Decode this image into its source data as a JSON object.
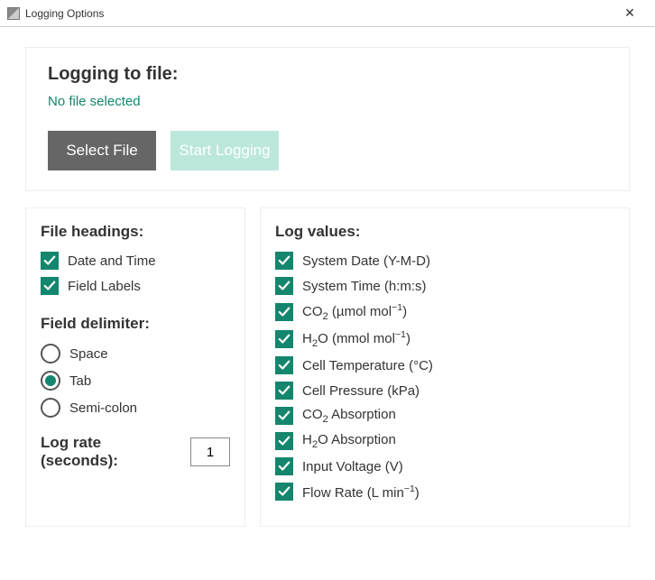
{
  "window": {
    "title": "Logging Options",
    "close_glyph": "✕"
  },
  "file_panel": {
    "heading": "Logging to file:",
    "status": "No file selected",
    "select_label": "Select File",
    "start_label": "Start Logging"
  },
  "left_panel": {
    "headings_title": "File headings:",
    "headings": [
      {
        "label": "Date and Time",
        "checked": true
      },
      {
        "label": "Field Labels",
        "checked": true
      }
    ],
    "delimiter_title": "Field delimiter:",
    "delimiters": [
      {
        "label": "Space",
        "checked": false
      },
      {
        "label": "Tab",
        "checked": true
      },
      {
        "label": "Semi-colon",
        "checked": false
      }
    ],
    "lograte_label": "Log rate (seconds):",
    "lograte_value": "1"
  },
  "right_panel": {
    "title": "Log values:",
    "items": [
      {
        "label_html": "System Date (Y-M-D)",
        "checked": true
      },
      {
        "label_html": "System Time (h:m:s)",
        "checked": true
      },
      {
        "label_html": "CO<sub>2</sub> (µmol mol<sup>−1</sup>)",
        "checked": true
      },
      {
        "label_html": "H<sub>2</sub>O (mmol mol<sup>−1</sup>)",
        "checked": true
      },
      {
        "label_html": "Cell Temperature (°C)",
        "checked": true
      },
      {
        "label_html": "Cell Pressure (kPa)",
        "checked": true
      },
      {
        "label_html": "CO<sub>2</sub> Absorption",
        "checked": true
      },
      {
        "label_html": "H<sub>2</sub>O Absorption",
        "checked": true
      },
      {
        "label_html": "Input Voltage (V)",
        "checked": true
      },
      {
        "label_html": "Flow Rate (L min<sup>−1</sup>)",
        "checked": true
      }
    ]
  }
}
